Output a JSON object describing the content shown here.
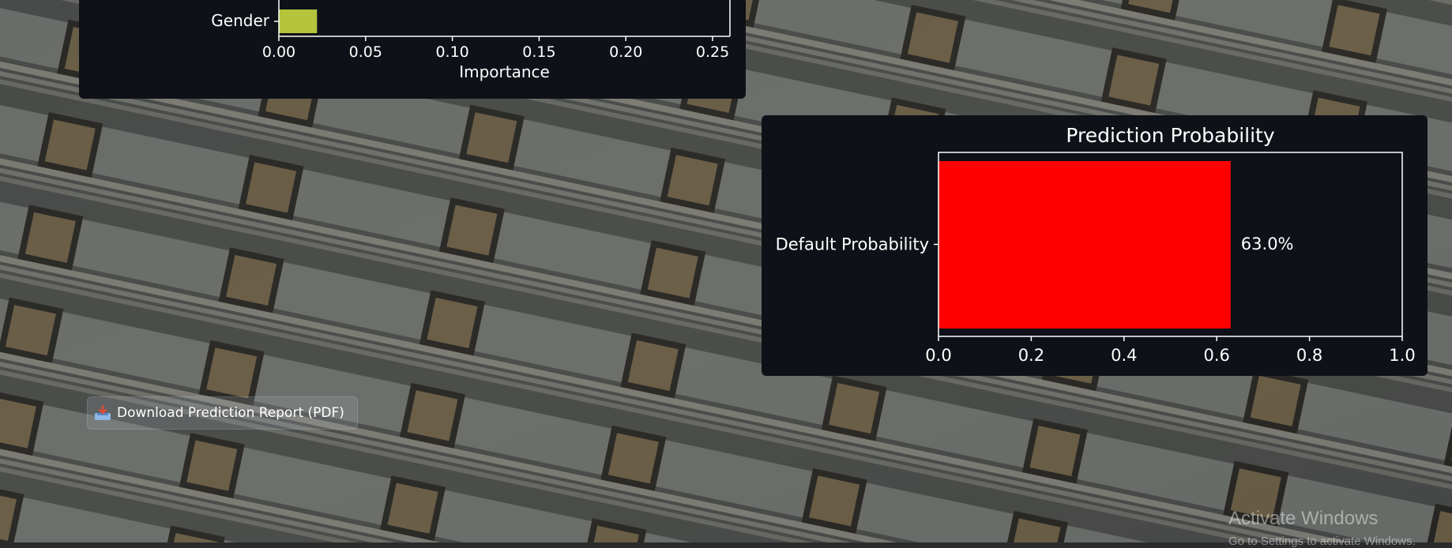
{
  "background": {
    "description_icon": "money-stacks-photo"
  },
  "colors": {
    "panel_bg": "#0e1117",
    "importance_bar": "#b5c43a",
    "prediction_bar": "#ff0000",
    "axis": "#ffffff"
  },
  "download_button": {
    "label": "Download Prediction Report (PDF)",
    "icon": "inbox-tray-icon"
  },
  "watermark": {
    "title": "Activate Windows",
    "subtitle": "Go to Settings to activate Windows."
  },
  "chart_data": [
    {
      "type": "bar",
      "orientation": "horizontal",
      "title": "",
      "xlabel": "Importance",
      "ylabel": "",
      "categories": [
        "Gender"
      ],
      "values": [
        0.022
      ],
      "partially_visible_bar_above": 0.022,
      "xlim": [
        0,
        0.26
      ],
      "xticks": [
        "0.00",
        "0.05",
        "0.10",
        "0.15",
        "0.20",
        "0.25"
      ],
      "grid": false
    },
    {
      "type": "bar",
      "orientation": "horizontal",
      "title": "Prediction Probability",
      "xlabel": "",
      "ylabel": "",
      "categories": [
        "Default Probability"
      ],
      "values": [
        0.63
      ],
      "data_labels": [
        "63.0%"
      ],
      "xlim": [
        0,
        1.0
      ],
      "xticks": [
        "0.0",
        "0.2",
        "0.4",
        "0.6",
        "0.8",
        "1.0"
      ],
      "grid": false
    }
  ]
}
